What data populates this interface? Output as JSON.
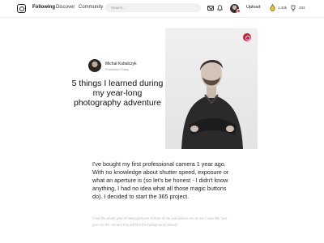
{
  "nav": {
    "links": [
      {
        "label": "Following",
        "active": true
      },
      {
        "label": "Discover",
        "active": false
      },
      {
        "label": "Community",
        "active": false
      }
    ],
    "search_placeholder": "Search...",
    "upload_label": "Upload",
    "stat_affection": "1.33k",
    "stat_views": "333"
  },
  "article": {
    "author_name": "Michał Kubalczyk",
    "author_sub": "Published Today",
    "title": "5 things I learned during my year-long photography adventure",
    "body": "I've bought my first professional camera 1 year ago. With no knowledge about shutter speed, exposure or what an aperture is (so let's be honest - I didn't know anything, I had no idea what all those magic buttons do). I decided to start the 365 project.",
    "faded": "I had the whole year of taking pictures in front of me and believe me or not, I was like \"just give me the camera that will blur the background already\""
  },
  "icons": {
    "logo": "camera-logo-icon",
    "mail": "mail-icon",
    "notifications": "bell-icon",
    "affection": "drop-icon",
    "views": "trophy-icon",
    "photo_badge": "instagram-icon"
  },
  "colors": {
    "accent": "#c81f3a",
    "text": "#111111",
    "muted": "#999999"
  }
}
